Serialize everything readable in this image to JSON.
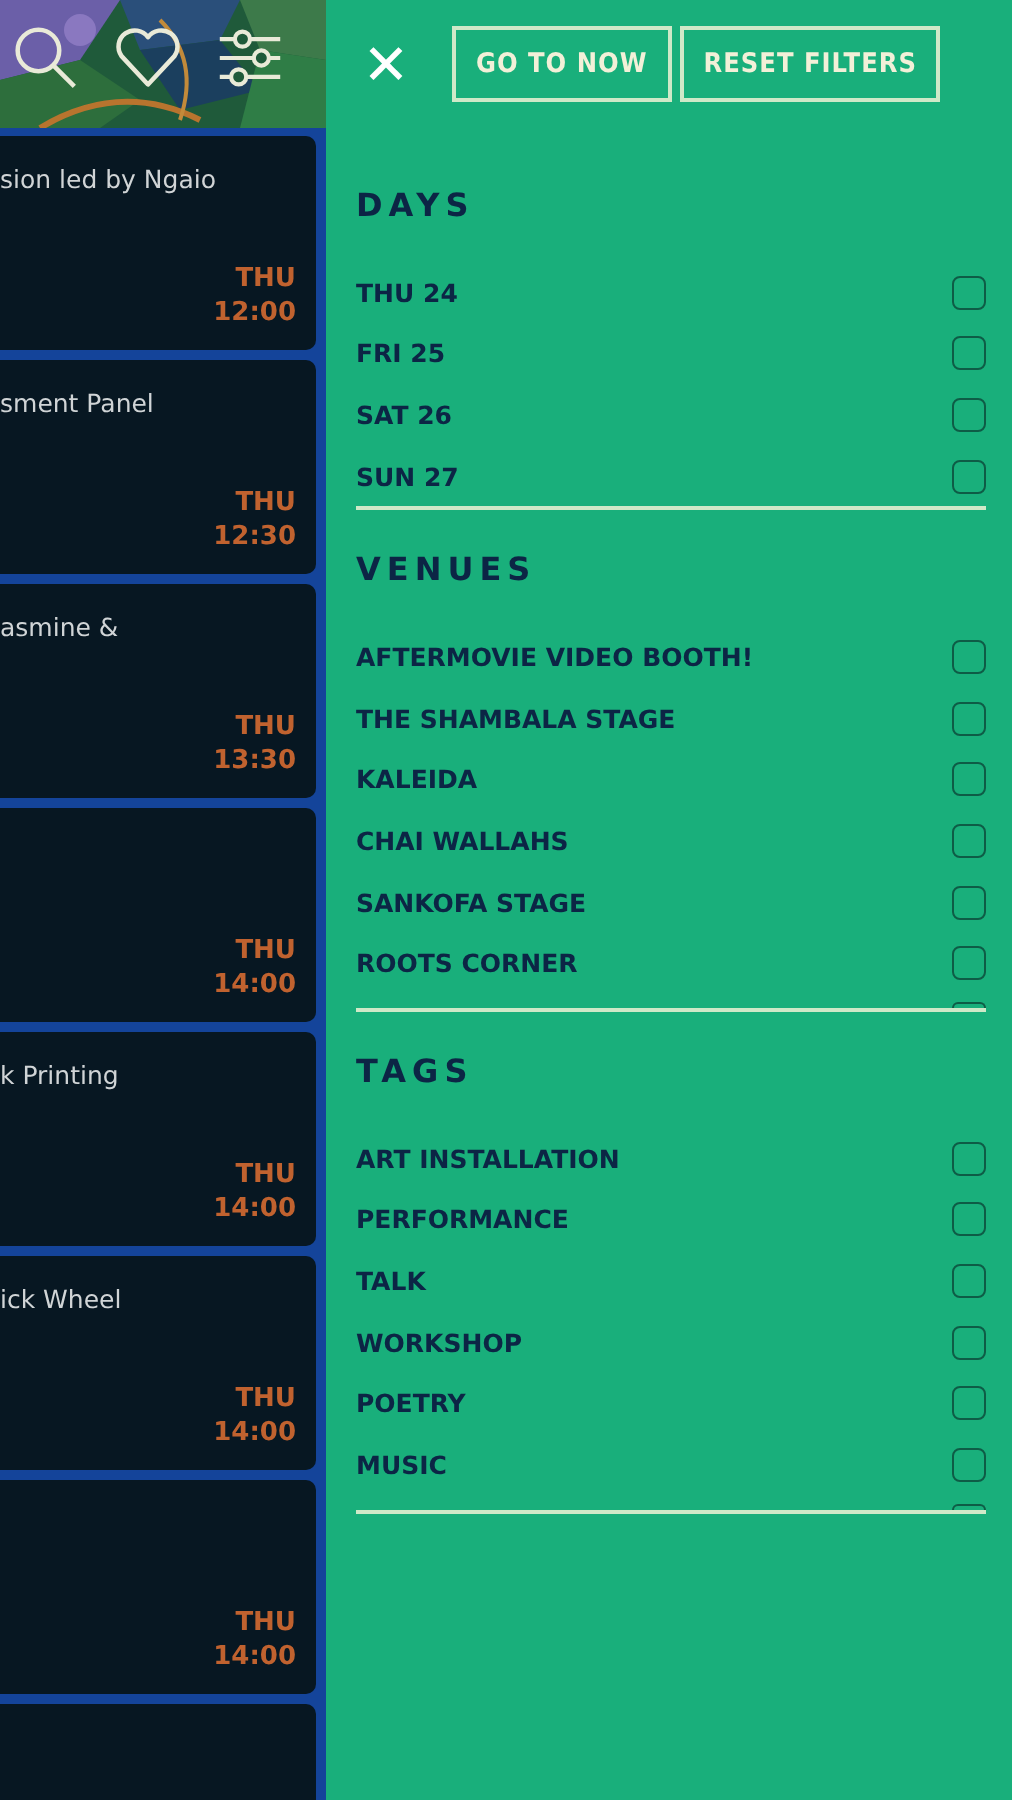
{
  "events": [
    {
      "title": "sion led by Ngaio",
      "day": "THU",
      "time": "12:00"
    },
    {
      "title": "sment Panel",
      "day": "THU",
      "time": "12:30"
    },
    {
      "title": "asmine &",
      "day": "THU",
      "time": "13:30"
    },
    {
      "day": "THU",
      "time": "14:00"
    },
    {
      "title": "k Printing",
      "day": "THU",
      "time": "14:00"
    },
    {
      "title": "ick Wheel",
      "day": "THU",
      "time": "14:00"
    },
    {
      "day": "THU",
      "time": "14:00"
    }
  ],
  "filters": {
    "close": "✕",
    "buttons": [
      "GO TO NOW",
      "RESET FILTERS"
    ],
    "sections": [
      {
        "heading": "DAYS",
        "more": false,
        "items": [
          {
            "label": "THU 24",
            "checked": false
          },
          {
            "label": "FRI 25",
            "checked": false
          },
          {
            "label": "SAT 26",
            "checked": false
          },
          {
            "label": "SUN 27",
            "checked": false
          }
        ]
      },
      {
        "heading": "VENUES",
        "more": true,
        "items": [
          {
            "label": "AFTERMOVIE VIDEO BOOTH!",
            "checked": false
          },
          {
            "label": "THE SHAMBALA STAGE",
            "checked": false
          },
          {
            "label": "KALEIDA",
            "checked": false
          },
          {
            "label": "CHAI WALLAHS",
            "checked": false
          },
          {
            "label": "SANKOFA STAGE",
            "checked": false
          },
          {
            "label": "ROOTS CORNER",
            "checked": false
          }
        ]
      },
      {
        "heading": "TAGS",
        "more": true,
        "items": [
          {
            "label": "ART INSTALLATION",
            "checked": false
          },
          {
            "label": "PERFORMANCE",
            "checked": false
          },
          {
            "label": "TALK",
            "checked": false
          },
          {
            "label": "WORKSHOP",
            "checked": false
          },
          {
            "label": "POETRY",
            "checked": false
          },
          {
            "label": "MUSIC",
            "checked": false
          }
        ]
      }
    ]
  }
}
